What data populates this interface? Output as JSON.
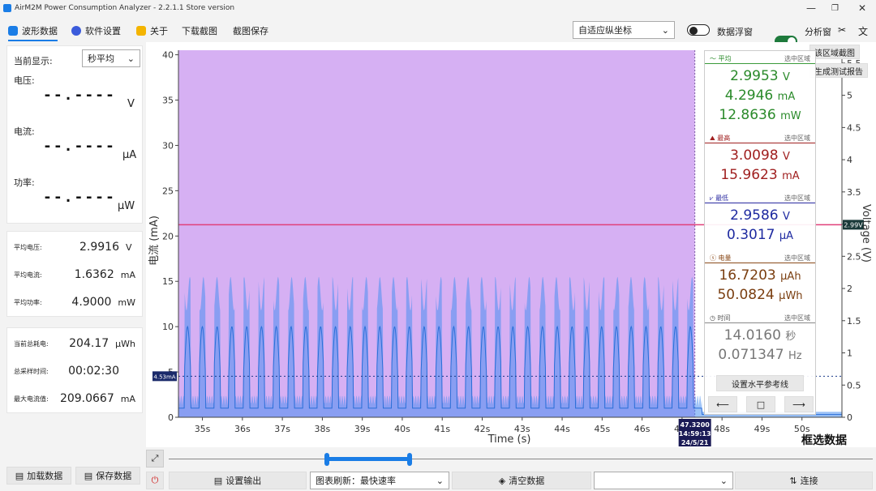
{
  "window": {
    "title": "AirM2M Power Consumption Analyzer - 2.2.1.1 Store version"
  },
  "menu": {
    "items": [
      "波形数据",
      "软件设置",
      "关于",
      "下载截图",
      "截图保存"
    ]
  },
  "toolbar": {
    "axis_mode": "自适应纵坐标",
    "float_label": "数据浮窗",
    "float_on": false,
    "analysis_label": "分析窗",
    "analysis_on": true
  },
  "left": {
    "current_display_label": "当前显示:",
    "current_display_value": "秒平均",
    "voltage_label": "电压:",
    "voltage_value": "--.----",
    "voltage_unit": "V",
    "current_label": "电流:",
    "current_value": "--.----",
    "current_unit": "μA",
    "power_label": "功率:",
    "power_value": "--.----",
    "power_unit": "μW",
    "avg": [
      {
        "k": "平均电压:",
        "v": "2.9916",
        "u": "V"
      },
      {
        "k": "平均电流:",
        "v": "1.6362",
        "u": "mA"
      },
      {
        "k": "平均功率:",
        "v": "4.9000",
        "u": "mW"
      }
    ],
    "totals": [
      {
        "k": "当前总耗电:",
        "v": "204.17",
        "u": "μWh"
      },
      {
        "k": "总采样时间:",
        "v": "00:02:30",
        "u": ""
      },
      {
        "k": "最大电流值:",
        "v": "209.0667",
        "u": "mA"
      }
    ],
    "load_button": "加载数据",
    "save_button": "保存数据"
  },
  "stats": {
    "region_label": "选中区域",
    "avg_title": "平均",
    "avg_v": "2.9953",
    "avg_i": "4.2946",
    "avg_p": "12.8636",
    "max_title": "最高",
    "max_v": "3.0098",
    "max_i": "15.9623",
    "min_title": "最低",
    "min_v": "2.9586",
    "min_i": "0.3017",
    "energy_title": "电量",
    "energy_q": "16.7203",
    "energy_e": "50.0824",
    "time_title": "时间",
    "time_s": "14.0160",
    "time_hz": "0.071347",
    "unit_v": "V",
    "unit_ma": "mA",
    "unit_mw": "mW",
    "unit_ua": "μA",
    "unit_uah": "μAh",
    "unit_uwh": "μWh",
    "unit_s": "秒",
    "unit_hz": "Hz",
    "set_ref_button": "设置水平参考线"
  },
  "chart_buttons": {
    "region_capture": "该区域截图",
    "gen_report": "生成测试报告"
  },
  "chart_data": {
    "type": "area",
    "xlabel": "Time (s)",
    "ylabel": "电流 (mA)",
    "y2label": "Voltage (V)",
    "xlim": [
      34.4,
      51
    ],
    "ylim": [
      0,
      40.5
    ],
    "y2lim": [
      0,
      5.7
    ],
    "x_ticks": [
      "35s",
      "36s",
      "37s",
      "38s",
      "39s",
      "40s",
      "41s",
      "42s",
      "43s",
      "44s",
      "45s",
      "46s",
      "47s",
      "48s",
      "49s",
      "50s"
    ],
    "y_ticks": [
      0,
      5,
      10,
      15,
      20,
      25,
      30,
      35,
      40
    ],
    "y2_ticks": [
      0,
      0.5,
      1,
      1.5,
      2,
      2.5,
      3,
      3.5,
      4,
      4.5,
      5,
      5.5
    ],
    "selection": [
      34.4,
      47.32
    ],
    "voltage_level": 2.99,
    "voltage_tag": "2.99V",
    "current_ref": 4.53,
    "current_tag": "4.53mA",
    "cursor_label": [
      "47.3200",
      "14:59:13",
      "24/5/21"
    ],
    "pulse_period_s": 0.37,
    "pulse_peak_mA": 15.5,
    "series": [
      {
        "name": "电流",
        "color": "#4a90f0"
      }
    ],
    "selection_color": "#d6b0f3",
    "voltage_color": "#e0407a"
  },
  "overlay_label": "框选数据",
  "bottom": {
    "output_button": "设置输出",
    "refresh": "图表刷新：最快速率",
    "clear_button": "清空数据",
    "port_select": "",
    "connect_button": "连接"
  }
}
